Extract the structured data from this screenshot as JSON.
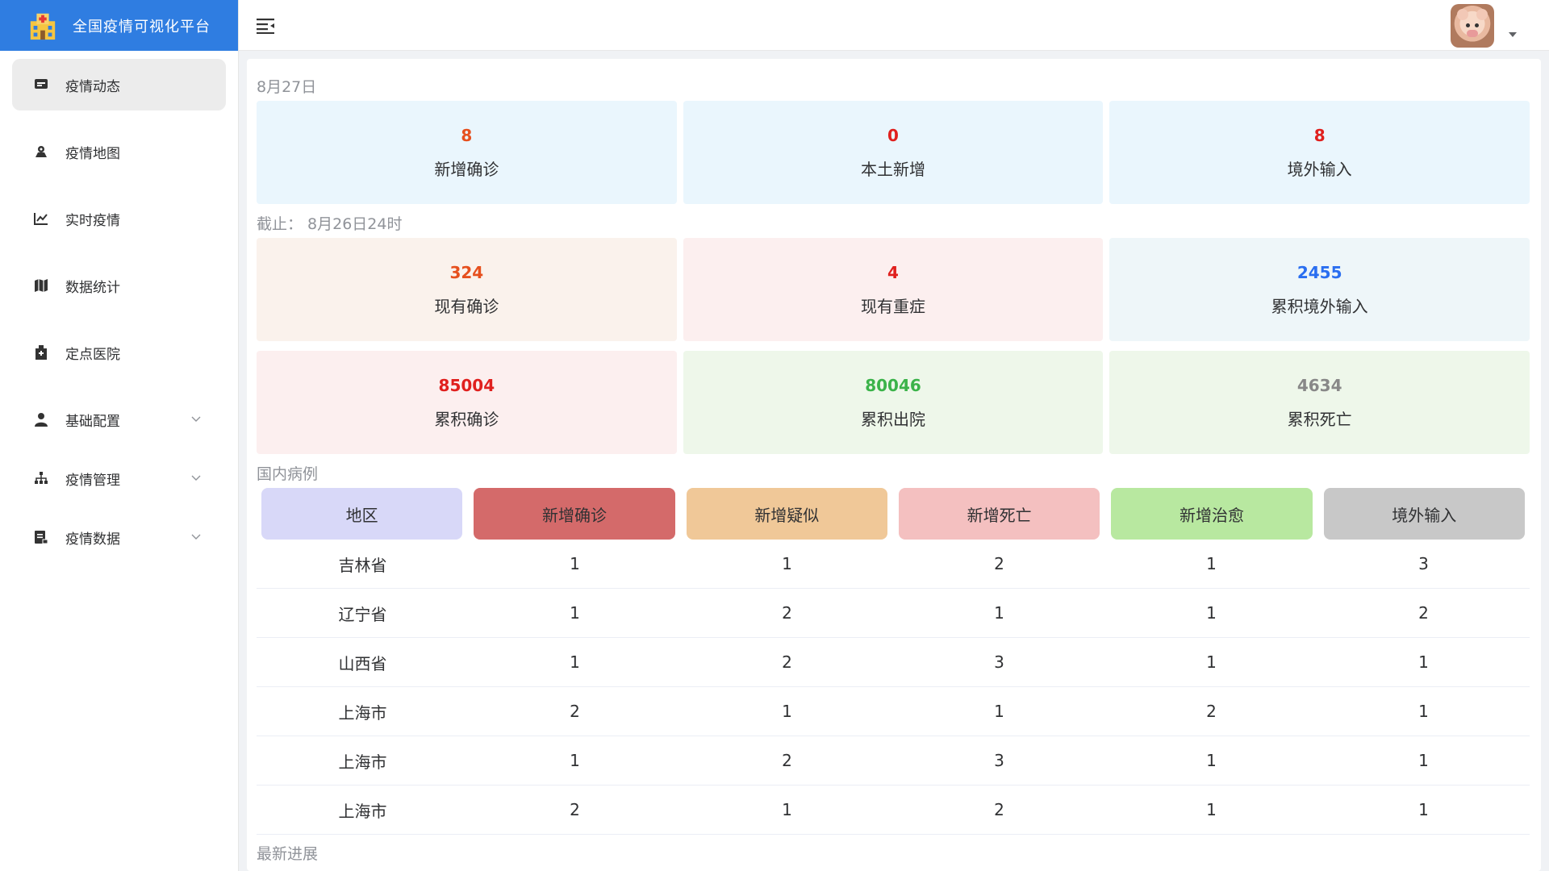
{
  "app": {
    "title": "全国疫情可视化平台"
  },
  "sidebar": {
    "items": [
      {
        "label": "疫情动态",
        "icon": "monitor-icon"
      },
      {
        "label": "疫情地图",
        "icon": "map-pin-icon"
      },
      {
        "label": "实时疫情",
        "icon": "line-chart-icon"
      },
      {
        "label": "数据统计",
        "icon": "map-icon"
      },
      {
        "label": "定点医院",
        "icon": "hospital-icon"
      },
      {
        "label": "基础配置",
        "icon": "user-icon"
      },
      {
        "label": "疫情管理",
        "icon": "org-chart-icon"
      },
      {
        "label": "疫情数据",
        "icon": "document-icon"
      }
    ]
  },
  "overview": {
    "date": "8月27日",
    "daily": [
      {
        "value": "8",
        "label": "新增确诊",
        "color": "#e6501e"
      },
      {
        "value": "0",
        "label": "本土新增",
        "color": "#e0201e"
      },
      {
        "value": "8",
        "label": "境外输入",
        "color": "#e0201e"
      }
    ],
    "cutoff": "截止：  8月26日24时",
    "totals_row1": [
      {
        "value": "324",
        "label": "现有确诊",
        "color": "#e6501e"
      },
      {
        "value": "4",
        "label": "现有重症",
        "color": "#e0201e"
      },
      {
        "value": "2455",
        "label": "累积境外输入",
        "color": "#2a6ef0"
      }
    ],
    "totals_row2": [
      {
        "value": "85004",
        "label": "累积确诊",
        "color": "#e0201e"
      },
      {
        "value": "80046",
        "label": "累积出院",
        "color": "#3bb34a"
      },
      {
        "value": "4634",
        "label": "累积死亡",
        "color": "#888888"
      }
    ]
  },
  "domestic": {
    "title": "国内病例",
    "columns": [
      "地区",
      "新增确诊",
      "新增疑似",
      "新增死亡",
      "新增治愈",
      "境外输入"
    ],
    "rows": [
      [
        "吉林省",
        "1",
        "1",
        "2",
        "1",
        "3"
      ],
      [
        "辽宁省",
        "1",
        "2",
        "1",
        "1",
        "2"
      ],
      [
        "山西省",
        "1",
        "2",
        "3",
        "1",
        "1"
      ],
      [
        "上海市",
        "2",
        "1",
        "1",
        "2",
        "1"
      ],
      [
        "上海市",
        "1",
        "2",
        "3",
        "1",
        "1"
      ],
      [
        "上海市",
        "2",
        "1",
        "2",
        "1",
        "1"
      ]
    ]
  },
  "progress": {
    "title": "最新进展"
  }
}
